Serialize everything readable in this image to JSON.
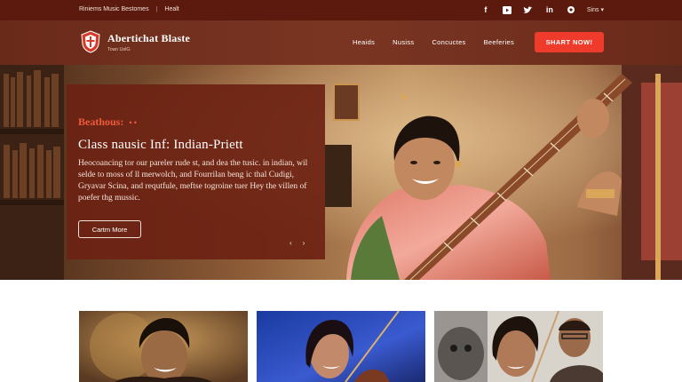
{
  "topbar": {
    "left_items": [
      "Riniems Music Bestomes",
      "Healt"
    ],
    "signin_label": "Sins",
    "social_icons": [
      "facebook-icon",
      "youtube-icon",
      "twitter-icon",
      "linkedin-icon",
      "gear-icon"
    ]
  },
  "header": {
    "brand_title": "Abertichat Blaste",
    "brand_subtitle": "Toan UslG",
    "nav": [
      "Heaids",
      "Nusiss",
      "Concuctes",
      "Beeferies"
    ],
    "cta_label": "SHART NOW!"
  },
  "hero": {
    "kicker": "Beathous:",
    "kicker_dots": "• •",
    "title": "Class nausic Inf: Indian-Priett",
    "body": "Heocoancing tor our pareler rude st, and dea the tusic. in indian, wil selde to moss of ll merwolch, and Fourrilan beng ic thal Cudigi, Gryavar Scina, and requtfule, meftse togroine tuer Hey the villen of poefer thg mussic.",
    "button_label": "Cartm More",
    "prev_label": "‹",
    "next_label": "›"
  },
  "colors": {
    "topbar_bg": "#5c1a0e",
    "header_bg": "#7a3522",
    "card_bg": "#6c2212",
    "accent": "#ef3b2b",
    "kicker": "#f05a3c"
  }
}
